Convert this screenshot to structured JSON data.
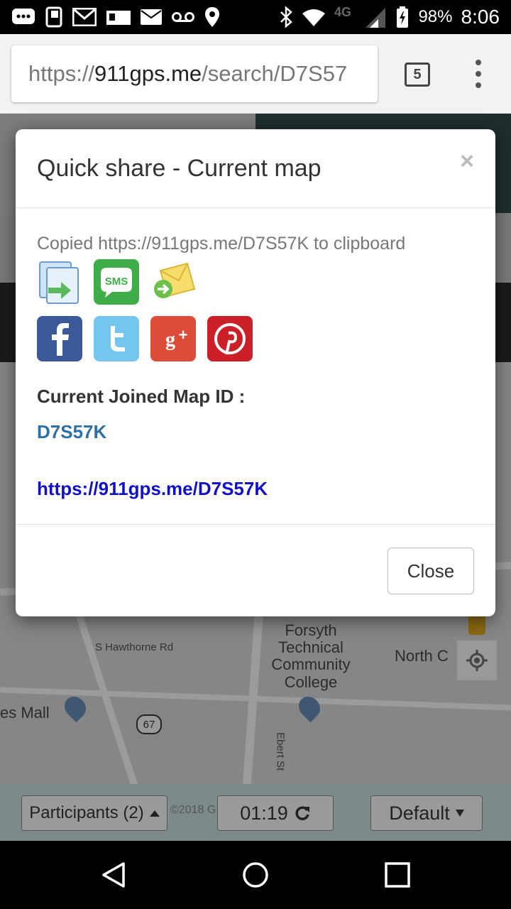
{
  "status_bar": {
    "battery": "98%",
    "time": "8:06",
    "network": "4G",
    "icons": [
      "message-icon",
      "nfc-icon",
      "gmail-icon",
      "map-notify-icon",
      "mail-icon",
      "voicemail-icon",
      "location-icon",
      "bluetooth-icon",
      "wifi-icon",
      "signal-icon",
      "battery-icon"
    ]
  },
  "browser": {
    "url_scheme": "https://",
    "url_host": "911gps.me",
    "url_path": "/search/D7S57",
    "tab_count": "5"
  },
  "modal": {
    "title": "Quick share - Current map",
    "close_symbol": "×",
    "copied_message": "Copied https://911gps.me/D7S57K to clipboard",
    "share_icons_row1": [
      "copy-icon",
      "sms-icon",
      "email-icon"
    ],
    "share_icons_row2": [
      "facebook-icon",
      "twitter-icon",
      "google-plus-icon",
      "pinterest-icon"
    ],
    "sms_label": "SMS",
    "joined_label": "Current Joined Map ID :",
    "map_id": "D7S57K",
    "map_link": "https://911gps.me/D7S57K",
    "close_button": "Close"
  },
  "background_map": {
    "labels": {
      "forsyth": "Forsyth Technical Community College",
      "hawthorne": "S Hawthorne Rd",
      "north": "North C",
      "mall": "es Mall",
      "ebert": "Ebert St",
      "route": "67"
    },
    "copyright": "©2018 G"
  },
  "bottom_toolbar": {
    "participants": "Participants (2)",
    "timer": "01:19",
    "mode": "Default"
  },
  "colors": {
    "map_id": "#2f6fa8",
    "link": "#1010cc",
    "sms": "#3fae49",
    "facebook": "#3b5998",
    "twitter": "#55acee",
    "google_plus": "#dd4b39",
    "pinterest": "#cb2027"
  }
}
